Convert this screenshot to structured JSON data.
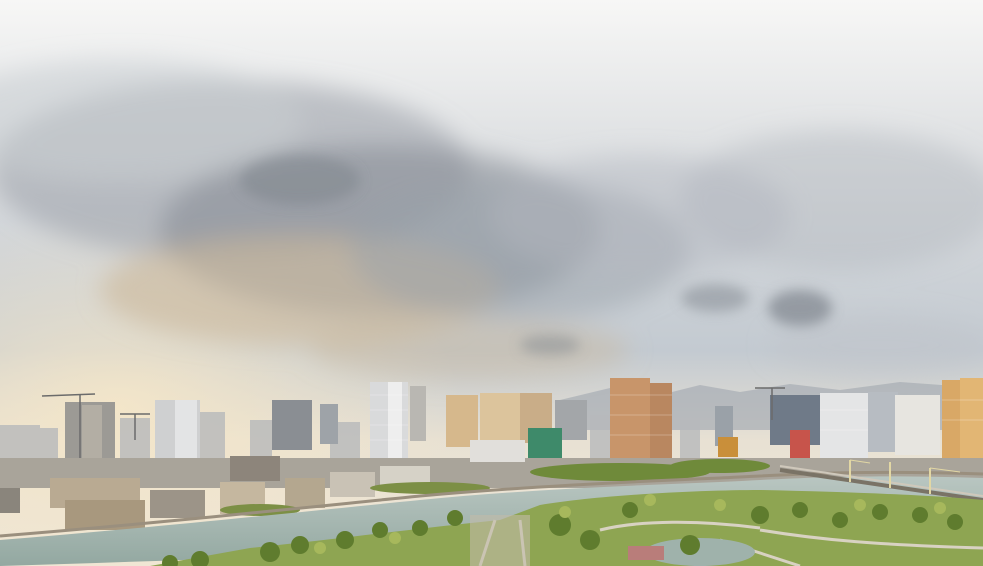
{
  "scene": {
    "subject": "city-skyline",
    "colors": {
      "sky_top": "#f4f5f6",
      "sky_mid": "#c9cfd6",
      "sky_horizon": "#e9dfcf",
      "cloud_dark": "#7b8088",
      "cloud_warm": "#d9c7ad",
      "building_light": "#d7d2c8",
      "building_warm": "#c89b66",
      "building_gray": "#8f959c",
      "river": "#a8b8b3",
      "park_green": "#8fa852",
      "tree_dark": "#556b2f"
    }
  }
}
